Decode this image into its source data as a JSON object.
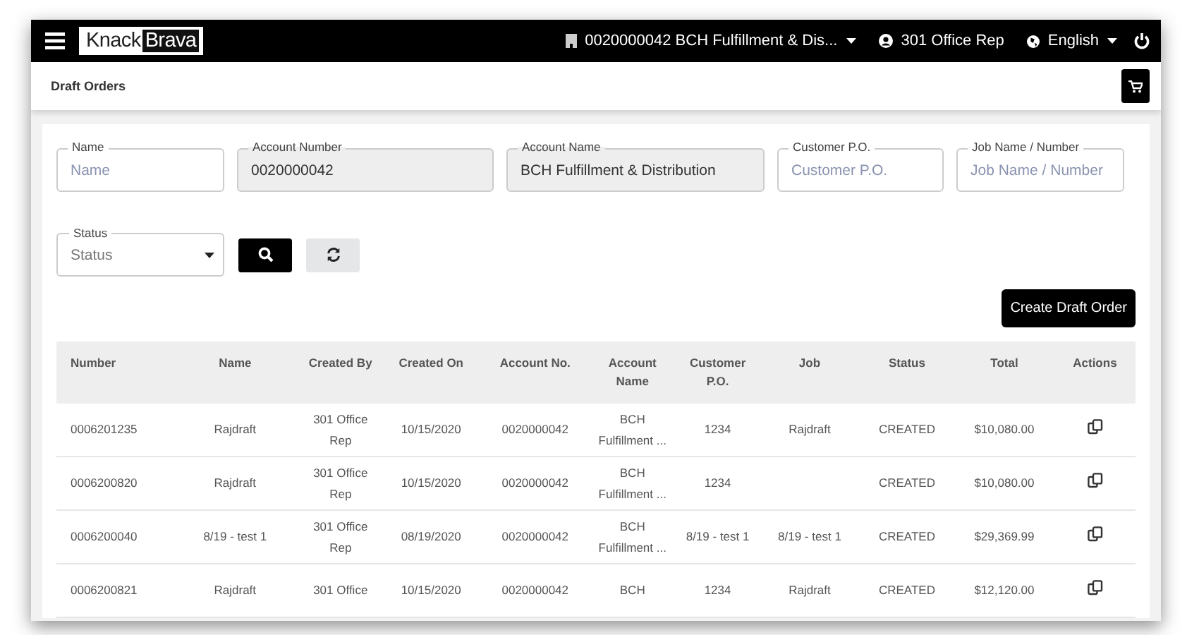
{
  "header": {
    "logo": [
      "Knack",
      "Brava"
    ],
    "account": "0020000042 BCH Fulfillment & Dis...",
    "user": "301 Office Rep",
    "language": "English"
  },
  "page_title": "Draft Orders",
  "filters": [
    {
      "label": "Name",
      "kind": "text",
      "placeholder": "Name"
    },
    {
      "label": "Account Number",
      "kind": "readonly",
      "value": "0020000042"
    },
    {
      "label": "Account Name",
      "kind": "readonly",
      "value": "BCH Fulfillment & Distribution"
    },
    {
      "label": "Customer P.O.",
      "kind": "text",
      "placeholder": "Customer P.O."
    },
    {
      "label": "Job Name / Number",
      "kind": "text",
      "placeholder": "Job Name / Number"
    },
    {
      "label": "Status",
      "kind": "select",
      "placeholder": "Status"
    }
  ],
  "create_button": "Create Draft Order",
  "table": {
    "columns": [
      "Number",
      "Name",
      "Created By",
      "Created On",
      "Account No.",
      "Account Name",
      "Customer P.O.",
      "Job",
      "Status",
      "Total",
      "Actions"
    ],
    "rows": [
      {
        "cells": [
          "0006201235",
          "Rajdraft",
          "301 Office Rep",
          "10/15/2020",
          "0020000042",
          "BCH Fulfillment ...",
          "1234",
          "Rajdraft",
          "CREATED",
          "$10,080.00"
        ]
      },
      {
        "cells": [
          "0006200820",
          "Rajdraft",
          "301 Office Rep",
          "10/15/2020",
          "0020000042",
          "BCH Fulfillment ...",
          "1234",
          "",
          "CREATED",
          "$10,080.00"
        ]
      },
      {
        "cells": [
          "0006200040",
          "8/19 - test 1",
          "301 Office Rep",
          "08/19/2020",
          "0020000042",
          "BCH Fulfillment ...",
          "8/19 - test 1",
          "8/19 - test 1",
          "CREATED",
          "$29,369.99"
        ]
      },
      {
        "cells": [
          "0006200821",
          "Rajdraft",
          "301 Office",
          "10/15/2020",
          "0020000042",
          "BCH",
          "1234",
          "Rajdraft",
          "CREATED",
          "$12,120.00"
        ]
      }
    ]
  }
}
